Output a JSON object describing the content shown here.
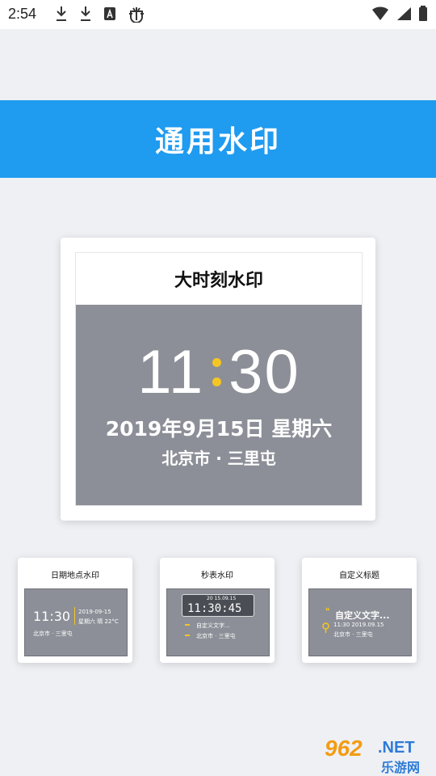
{
  "status_bar": {
    "time": "2:54"
  },
  "banner": {
    "title": "通用水印"
  },
  "main_card": {
    "title": "大时刻水印",
    "hour": "11",
    "minute": "30",
    "date": "2019年9月15日  星期六",
    "location": "北京市 · 三里屯"
  },
  "cards": [
    {
      "title": "日期地点水印",
      "time": "11:30",
      "date": "2019-09-15",
      "weekday_temp": "星期六 晴 22°C",
      "location": "北京市 · 三里屯"
    },
    {
      "title": "秒表水印",
      "clock_date": "20 15.09.15",
      "clock_time": "11:30:45",
      "line1": "自定义文字...",
      "line2": "北京市 · 三里屯"
    },
    {
      "title": "自定义标题",
      "text": "自定义文字...",
      "time_date": "11:30  2019.09.15",
      "location": "北京市 · 三里屯"
    }
  ],
  "watermark": {
    "number": "962",
    "suffix": ".NET",
    "name": "乐游网"
  },
  "colors": {
    "banner": "#1f9bf0",
    "accent": "#f5c623",
    "preview_bg": "#8c8f97"
  }
}
